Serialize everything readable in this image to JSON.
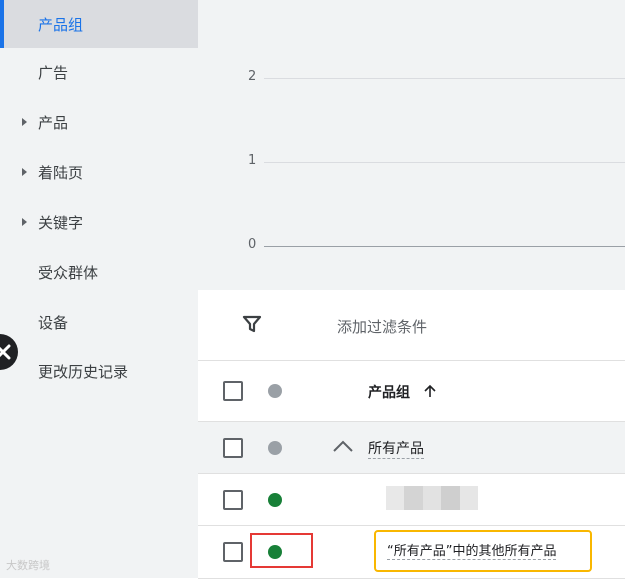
{
  "sidebar": {
    "items": [
      {
        "label": "产品组"
      },
      {
        "label": "广告"
      },
      {
        "label": "产品"
      },
      {
        "label": "着陆页"
      },
      {
        "label": "关键字"
      },
      {
        "label": "受众群体"
      },
      {
        "label": "设备"
      },
      {
        "label": "更改历史记录"
      }
    ]
  },
  "chart": {
    "ticks": [
      "2",
      "1",
      "0"
    ]
  },
  "chart_data": {
    "type": "line",
    "yticks": [
      0,
      1,
      2
    ],
    "ylim": [
      0,
      2
    ],
    "series": []
  },
  "filter": {
    "label": "添加过滤条件",
    "icon": "filter-icon"
  },
  "table": {
    "column_header": "产品组",
    "sort_icon": "arrow-up-icon",
    "group_row": {
      "label": "所有产品",
      "status_color": "#9aa0a6"
    },
    "rows": [
      {
        "status_color": "#188038"
      },
      {
        "label": "“所有产品”中的其他所有产品",
        "status_color": "#188038"
      }
    ]
  },
  "watermark": "大数跨境",
  "colors": {
    "accent": "#1a73e8",
    "status_green": "#188038",
    "highlight_red": "#e53935",
    "highlight_yellow": "#f9b700"
  }
}
